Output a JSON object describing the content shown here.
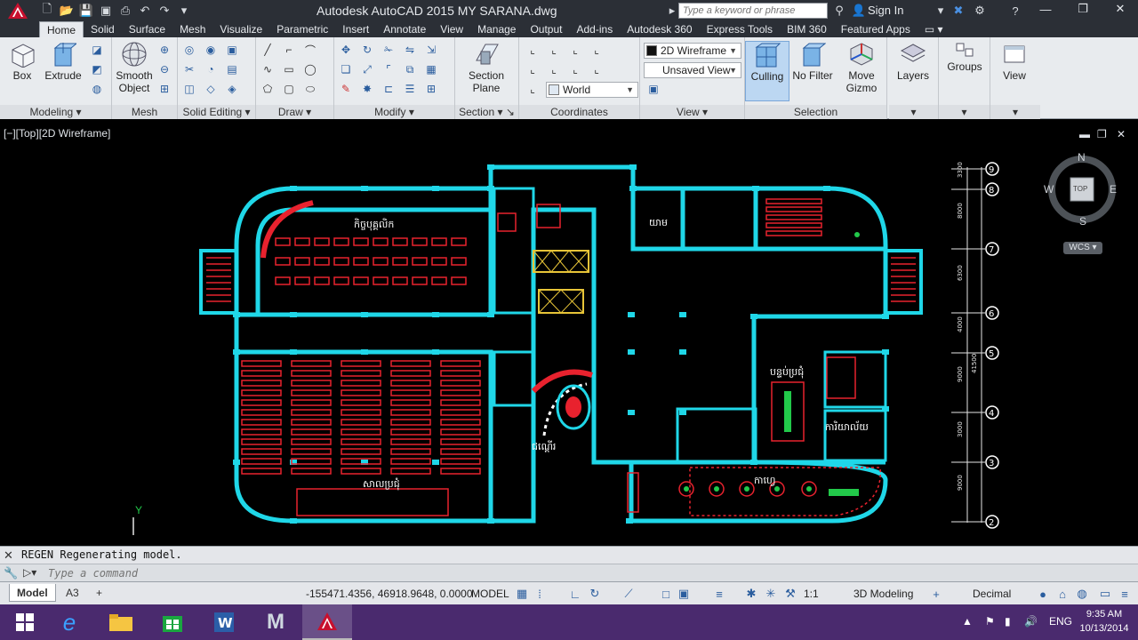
{
  "app": {
    "title": "Autodesk AutoCAD 2015    MY SARANA.dwg",
    "search_placeholder": "Type a keyword or phrase",
    "sign_in": "Sign In"
  },
  "tabs": [
    "Home",
    "Solid",
    "Surface",
    "Mesh",
    "Visualize",
    "Parametric",
    "Insert",
    "Annotate",
    "View",
    "Manage",
    "Output",
    "Add-ins",
    "Autodesk 360",
    "Express Tools",
    "BIM 360",
    "Featured Apps"
  ],
  "active_tab": "Home",
  "ribbon": {
    "modeling": {
      "title": "Modeling",
      "box": "Box",
      "extrude": "Extrude"
    },
    "mesh": {
      "title": "Mesh",
      "smooth_line1": "Smooth",
      "smooth_line2": "Object"
    },
    "solid_editing": {
      "title": "Solid Editing"
    },
    "draw": {
      "title": "Draw"
    },
    "modify": {
      "title": "Modify"
    },
    "section": {
      "title": "Section",
      "plane_line1": "Section",
      "plane_line2": "Plane"
    },
    "coordinates": {
      "title": "Coordinates",
      "world": "World"
    },
    "view": {
      "title": "View",
      "visual_style": "2D Wireframe",
      "named_view": "Unsaved View"
    },
    "selection": {
      "title": "Selection",
      "culling": "Culling",
      "no_filter": "No Filter",
      "move_gizmo_line1": "Move",
      "move_gizmo_line2": "Gizmo"
    },
    "layers": "Layers",
    "groups": "Groups",
    "view_btn": "View"
  },
  "viewport": {
    "label": "[−][Top][2D Wireframe]",
    "viewcube": {
      "n": "N",
      "s": "S",
      "e": "E",
      "w": "W",
      "top": "TOP",
      "wcs": "WCS"
    },
    "ucs_y": "Y",
    "plan_labels": {
      "reception": "កិច្ចបុគ្គលិក",
      "meeting_hall": "សាលប្រជុំ",
      "stairs": "ជណ្ដើរ",
      "guard": "យាម",
      "cafe": "កាហ្វេ",
      "meeting_room": "បន្ទប់ប្រជុំ",
      "office": "ការិយាល័យ"
    },
    "dimensions": [
      "3300",
      "8000",
      "6300",
      "4000",
      "9000",
      "3000",
      "9000",
      "41500"
    ],
    "grid_bubbles": [
      "9",
      "8",
      "7",
      "6",
      "5",
      "4",
      "3",
      "2"
    ]
  },
  "command": {
    "history": "REGEN Regenerating model.",
    "placeholder": "Type a command"
  },
  "status": {
    "tabs": [
      "Model",
      "A3"
    ],
    "coords": "-155471.4356, 46918.9648, 0.0000",
    "space": "MODEL",
    "scale": "1:1",
    "workspace": "3D Modeling",
    "units": "Decimal"
  },
  "taskbar": {
    "lang": "ENG",
    "time": "9:35 AM",
    "date": "10/13/2014"
  },
  "colors": {
    "wall": "#1fd7e8",
    "furniture": "#e8222e",
    "accent_green": "#22c94a",
    "ribbon_bg": "#e8ebee"
  }
}
